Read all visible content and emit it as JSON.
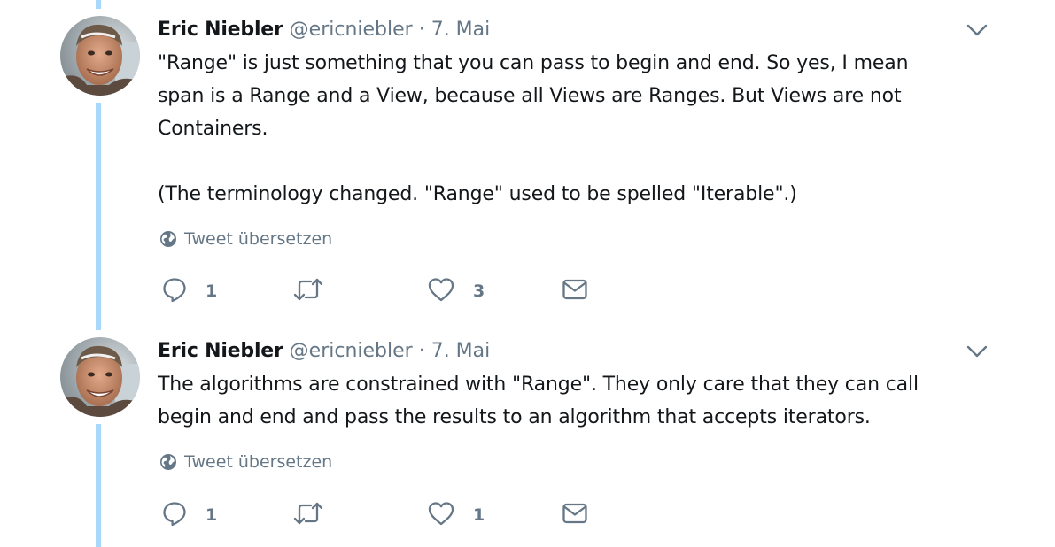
{
  "tweets": [
    {
      "author": {
        "name": "Eric Niebler",
        "handle": "@ericniebler"
      },
      "separator": "·",
      "date": "7. Mai",
      "text": "\"Range\" is just something that you can pass to begin and end. So yes, I mean\nspan is a Range and a View, because all Views are Ranges. But Views are not\nContainers.\n\n(The terminology changed. \"Range\" used to be spelled \"Iterable\".)",
      "translate_label": "Tweet übersetzen",
      "actions": {
        "replies": "1",
        "retweets": "",
        "likes": "3"
      }
    },
    {
      "author": {
        "name": "Eric Niebler",
        "handle": "@ericniebler"
      },
      "separator": "·",
      "date": "7. Mai",
      "text": "The algorithms are constrained with \"Range\". They only care that they can call\nbegin and end and pass the results to an algorithm that accepts iterators.",
      "translate_label": "Tweet übersetzen",
      "actions": {
        "replies": "1",
        "retweets": "",
        "likes": "1"
      }
    }
  ],
  "icons": {
    "reply": "reply-icon",
    "retweet": "retweet-icon",
    "like": "heart-icon",
    "dm": "envelope-icon",
    "caret": "chevron-down-icon",
    "translate": "globe-icon"
  },
  "colors": {
    "text": "#14171a",
    "secondary": "#657786",
    "thread_line": "#a8d9fb",
    "background": "#ffffff"
  }
}
